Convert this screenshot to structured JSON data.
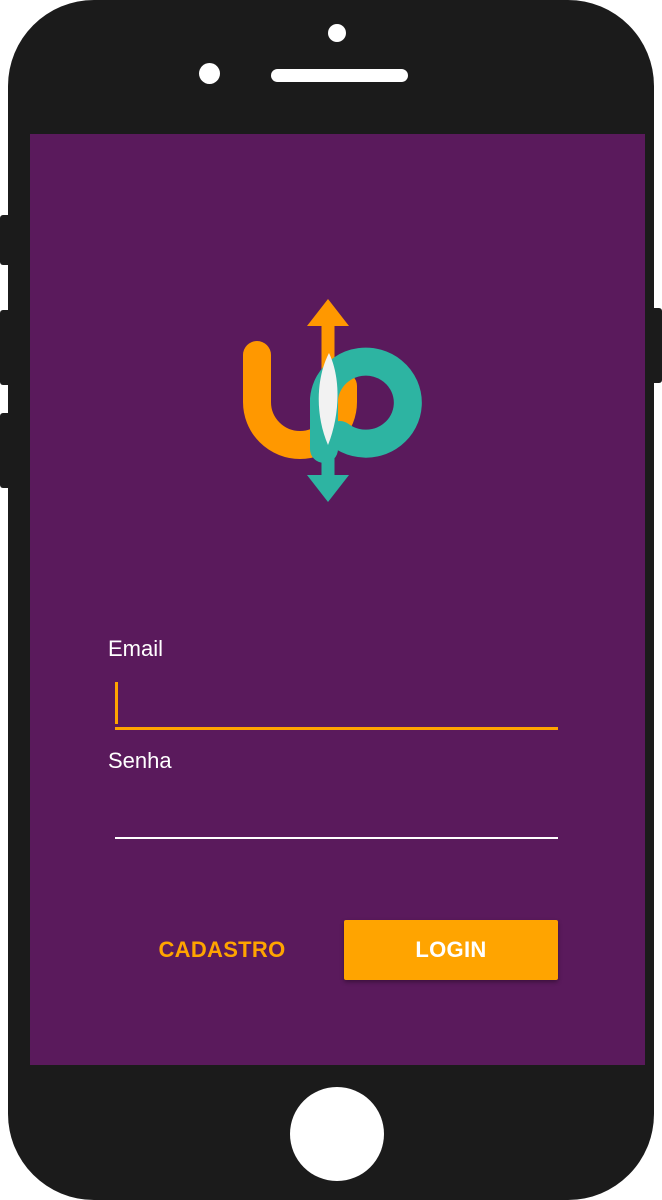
{
  "theme": {
    "background": "#5a1a5c",
    "accent": "#ffa400",
    "logo_orange": "#ff9800",
    "logo_teal": "#2db4a2",
    "text": "#ffffff"
  },
  "logo": {
    "icon": "up-arrows-logo"
  },
  "form": {
    "email": {
      "label": "Email",
      "value": "",
      "placeholder": ""
    },
    "password": {
      "label": "Senha",
      "value": "",
      "placeholder": ""
    }
  },
  "actions": {
    "signup_label": "CADASTRO",
    "login_label": "LOGIN"
  }
}
